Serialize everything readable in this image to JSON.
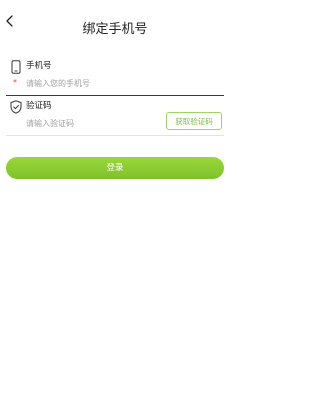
{
  "header": {
    "title": "绑定手机号",
    "back_icon": "chevron-left-icon"
  },
  "phone": {
    "label": "手机号",
    "required_mark": "*",
    "placeholder": "请输入您的手机号",
    "value": "",
    "icon": "smartphone-icon"
  },
  "code": {
    "label": "验证码",
    "placeholder": "请输入验证码",
    "value": "",
    "icon": "shield-check-icon",
    "get_code_label": "获取验证码"
  },
  "login": {
    "label": "登录"
  },
  "colors": {
    "accent": "#8ccd32",
    "accent_text": "#7cc043",
    "required": "#e8453c",
    "placeholder": "#a0a0a0"
  }
}
